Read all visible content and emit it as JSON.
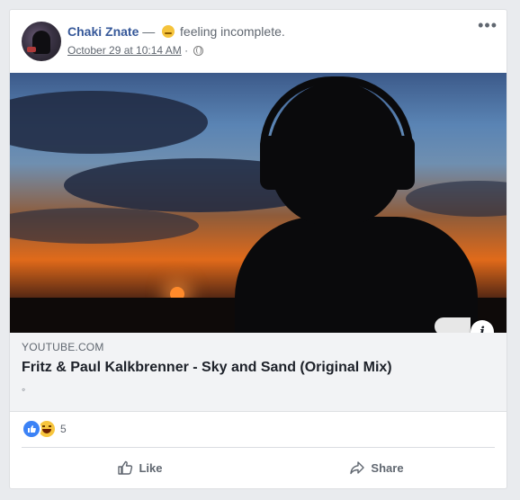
{
  "post": {
    "author": "Chaki Znate",
    "separator": "—",
    "feeling": "feeling incomplete.",
    "timestamp": "October 29 at 10:14 AM",
    "meta_separator": "·",
    "privacy_icon": "globe-icon",
    "more_label": "•••"
  },
  "link": {
    "domain": "YOUTUBE.COM",
    "title": "Fritz & Paul Kalkbrenner - Sky and Sand (Original Mix)",
    "description": "◦",
    "info_label": "i"
  },
  "reactions": {
    "types": [
      "like",
      "haha"
    ],
    "count": "5"
  },
  "actions": {
    "like_label": "Like",
    "share_label": "Share"
  },
  "colors": {
    "author": "#365899",
    "muted": "#606770",
    "link_bg": "#f2f3f5"
  }
}
